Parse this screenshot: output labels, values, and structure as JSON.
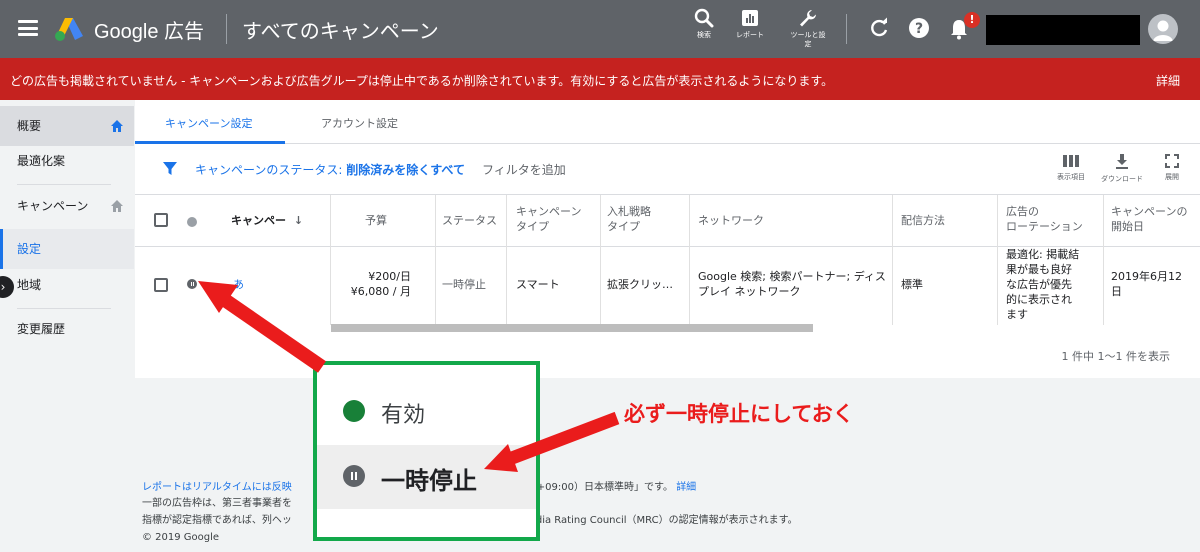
{
  "header": {
    "brand": "Google 広告",
    "page_title": "すべてのキャンペーン",
    "tools": [
      {
        "icon": "search-icon",
        "label": "検索"
      },
      {
        "icon": "report-icon",
        "label": "レポート"
      },
      {
        "icon": "wrench-icon",
        "label": "ツールと設定"
      }
    ],
    "notification_count": "!"
  },
  "banner": {
    "message": "どの広告も掲載されていません - キャンペーンおよび広告グループは停止中であるか削除されています。有効にすると広告が表示されるようになります。",
    "link": "詳細"
  },
  "sidebar": {
    "items": [
      {
        "label": "概要"
      },
      {
        "label": "最適化案"
      },
      {
        "label": "キャンペーン"
      },
      {
        "label": "設定"
      },
      {
        "label": "地域"
      },
      {
        "label": "変更履歴"
      }
    ],
    "collapse_glyph": "›"
  },
  "tabs": [
    {
      "label": "キャンペーン設定"
    },
    {
      "label": "アカウント設定"
    }
  ],
  "filter": {
    "prefix": "キャンペーンのステータス: ",
    "value": "削除済みを除くすべて",
    "add": "フィルタを追加"
  },
  "table_tools": [
    {
      "icon": "columns-icon",
      "label": "表示項目"
    },
    {
      "icon": "download-icon",
      "label": "ダウンロード"
    },
    {
      "icon": "expand-icon",
      "label": "展開"
    }
  ],
  "table": {
    "headers": {
      "campaign": "キャンペー",
      "budget": "予算",
      "status": "ステータス",
      "type": [
        "キャンペーン",
        "タイプ"
      ],
      "bidding": [
        "入札戦略",
        "タイプ"
      ],
      "network": "ネットワーク",
      "delivery": "配信方法",
      "rotation": [
        "広告の",
        "ローテーション"
      ],
      "start": [
        "キャンペーンの",
        "開始日"
      ]
    },
    "row": {
      "campaign": "あ",
      "budget": [
        "¥200/日",
        "¥6,080 / 月"
      ],
      "status": "一時停止",
      "type": "スマート",
      "bidding": "拡張クリッ…",
      "network": [
        "Google 検索; 検索パートナー; ディス",
        "プレイ ネットワーク"
      ],
      "delivery": "標準",
      "rotation": [
        "最適化: 掲載結",
        "果が最も良好",
        "な広告が優先",
        "的に表示され",
        "ます"
      ],
      "start": [
        "2019年6月12",
        "日"
      ]
    },
    "pagination": "1 件中 1〜1 件を表示"
  },
  "footer": {
    "line1_link": "レポートはリアルタイムには反映",
    "line1_tail": "べて「（GMT+09:00）日本標準時」です。",
    "line1_more": "詳細",
    "line2_head": "一部の広告枠は、第三者事業者を",
    "line2_tail": "す。",
    "line3_head": "指標が認定指標であれば、列ヘッ",
    "line3_tail": "ーに Media Rating Council（MRC）の認定情報が表示されます。",
    "copyright": "© 2019 Google"
  },
  "callout": {
    "enabled": "有効",
    "paused": "一時停止"
  },
  "annotation": {
    "note": "必ず一時停止にしておく"
  },
  "colors": {
    "topbar": "#5f6368",
    "banner": "#c5221f",
    "accent": "#1a73e8",
    "callout_border": "#12a84a",
    "arrow": "#ea1c1c",
    "enabled_dot": "#188038"
  }
}
